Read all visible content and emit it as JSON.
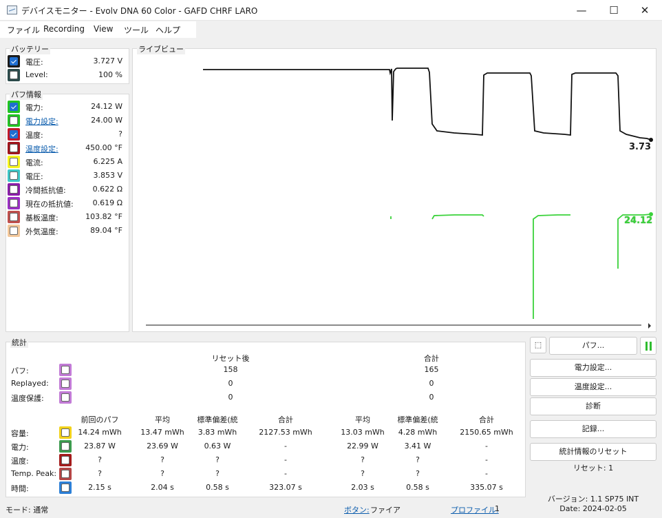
{
  "window": {
    "title": "デバイスモニター - Evolv DNA 60 Color - GAFD CHRF LARO",
    "minimize": "—",
    "maximize": "☐",
    "close": "✕"
  },
  "menu": [
    "ファイル",
    "Recording",
    "View",
    "ツール",
    "ヘルプ"
  ],
  "battery": {
    "title": "バッテリー",
    "rows": [
      {
        "label": "電圧:",
        "value": "3.727 V",
        "color": "#1b1b1b",
        "checked": true,
        "link": false
      },
      {
        "label": "Level:",
        "value": "100 %",
        "color": "#2b4a4a",
        "checked": false,
        "link": false
      }
    ]
  },
  "puff_info": {
    "title": "パフ情報",
    "rows": [
      {
        "label": "電力:",
        "value": "24.12 W",
        "color": "#22c422",
        "checked": true,
        "link": false
      },
      {
        "label": "電力設定:",
        "value": "24.00 W",
        "color": "#22c422",
        "checked": false,
        "link": true
      },
      {
        "label": "温度:",
        "value": "?",
        "color": "#c0182a",
        "checked": true,
        "link": false
      },
      {
        "label": "温度設定:",
        "value": "450.00 °F",
        "color": "#a0141c",
        "checked": false,
        "link": true
      },
      {
        "label": "電流:",
        "value": "6.225 A",
        "color": "#f5f520",
        "checked": false,
        "link": false
      },
      {
        "label": "電圧:",
        "value": "3.853 V",
        "color": "#3ec6c6",
        "checked": false,
        "link": false
      },
      {
        "label": "冷間抵抗値:",
        "value": "0.622 Ω",
        "color": "#8a1ea8",
        "checked": false,
        "link": false
      },
      {
        "label": "現在の抵抗値:",
        "value": "0.619 Ω",
        "color": "#9b30c4",
        "checked": false,
        "link": false
      },
      {
        "label": "基板温度:",
        "value": "103.82 °F",
        "color": "#c0504d",
        "checked": false,
        "link": false
      },
      {
        "label": "外気温度:",
        "value": "89.04 °F",
        "color": "#f3c89b",
        "checked": false,
        "link": false
      }
    ]
  },
  "live_view": {
    "title": "ライブビュー",
    "voltage_readout": "3.73",
    "power_readout": "24.12",
    "voltage_color": "#111111",
    "power_color": "#3ad23a"
  },
  "stats": {
    "title": "統計",
    "header_reset": "リセット後",
    "header_total": "合計",
    "top_rows": [
      {
        "label": "パフ:",
        "reset": "158",
        "total": "165",
        "color": "#c27bd6"
      },
      {
        "label": "Replayed:",
        "reset": "0",
        "total": "0",
        "color": "#c27bd6"
      },
      {
        "label": "温度保護:",
        "reset": "0",
        "total": "0",
        "color": "#c27bd6"
      }
    ],
    "columns": [
      "前回のパフ",
      "平均",
      "標準偏差(統",
      "合計",
      "平均",
      "標準偏差(統",
      "合計"
    ],
    "rows": [
      {
        "label": "容量:",
        "color": "#f2d21a",
        "values": [
          "14.24 mWh",
          "13.47 mWh",
          "3.83 mWh",
          "2127.53 mWh",
          "13.03 mWh",
          "4.28 mWh",
          "2150.65 mWh"
        ]
      },
      {
        "label": "電力:",
        "color": "#3c9a4e",
        "values": [
          "23.87 W",
          "23.69 W",
          "0.63 W",
          "-",
          "22.99 W",
          "3.41 W",
          "-"
        ]
      },
      {
        "label": "温度:",
        "color": "#a31b1b",
        "values": [
          "?",
          "?",
          "?",
          "-",
          "?",
          "?",
          "-"
        ]
      },
      {
        "label": "Temp. Peak:",
        "color": "#b44545",
        "values": [
          "?",
          "?",
          "?",
          "-",
          "?",
          "?",
          "-"
        ]
      },
      {
        "label": "時間:",
        "color": "#2c7fd6",
        "values": [
          "2.15 s",
          "2.04 s",
          "0.58 s",
          "323.07 s",
          "2.03 s",
          "0.58 s",
          "335.07 s"
        ]
      }
    ]
  },
  "controls": {
    "puff_button": "パフ...",
    "power_settings": "電力設定...",
    "temp_settings": "温度設定...",
    "diagnostics": "診断",
    "record": "記録...",
    "reset_stats": "統計情報のリセット",
    "reset_count": "リセット: 1",
    "pause_color": "#2fbd2f"
  },
  "status": {
    "mode": "モード: 通常",
    "button_label": "ボタン:",
    "button_value": "ファイア",
    "profile_label": "プロファイル:",
    "profile_value": "1",
    "version": "バージョン: 1.1 SP75 INT",
    "date": "Date: 2024-02-05"
  }
}
